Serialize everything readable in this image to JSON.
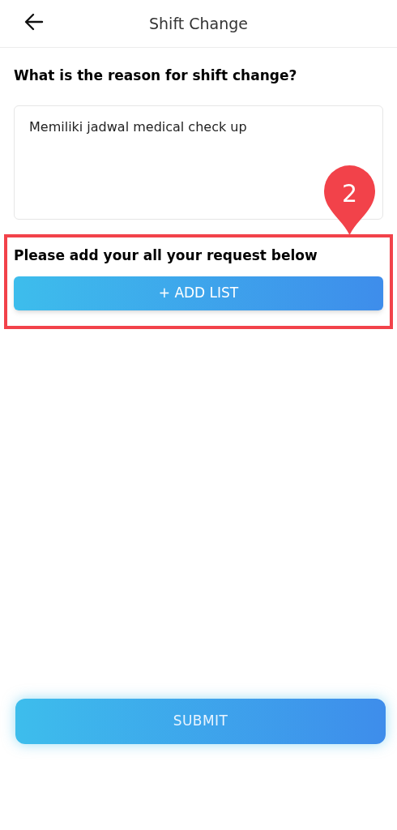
{
  "header": {
    "title": "Shift Change"
  },
  "question": "What is the reason for shift change?",
  "reason_field": {
    "value": "Memiliki jadwal medical check up"
  },
  "annotation": {
    "number": "2"
  },
  "request_section": {
    "label": "Please add your all your request below",
    "add_button": "+ ADD LIST"
  },
  "submit_button": "SUBMIT"
}
